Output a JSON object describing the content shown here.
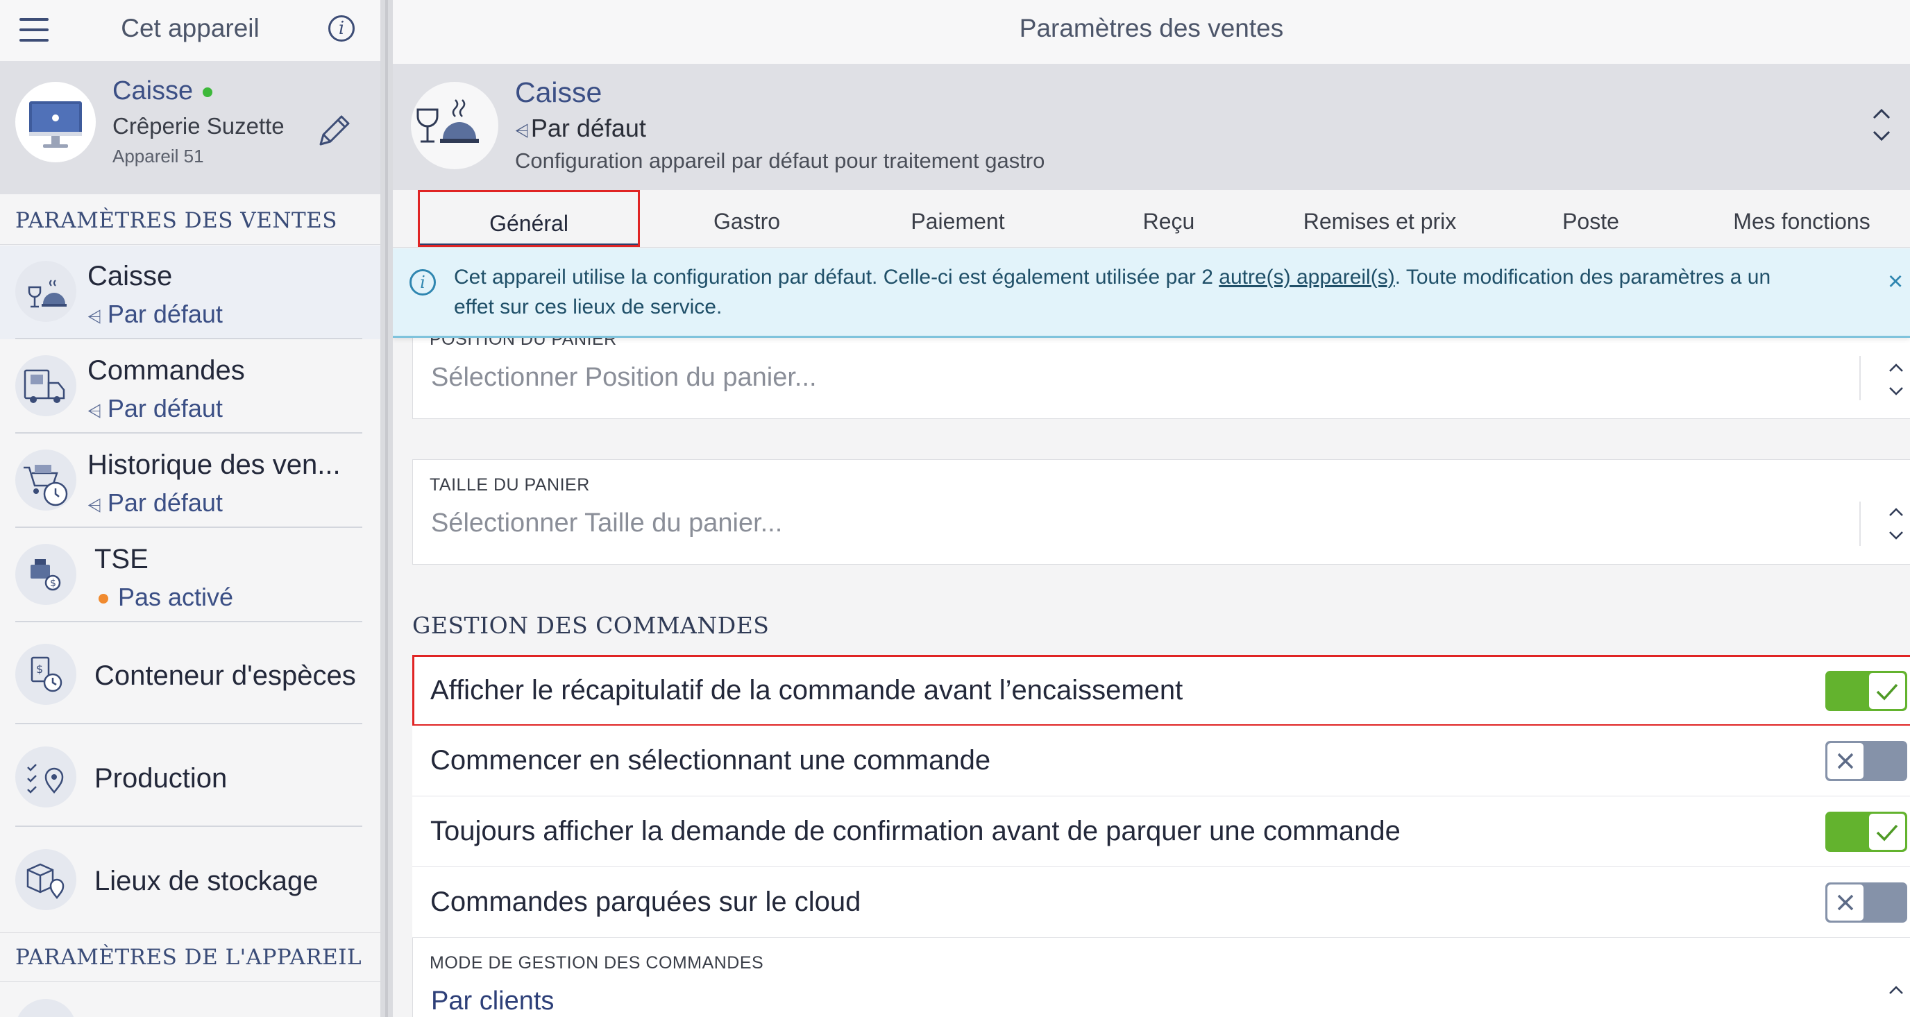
{
  "sidebar": {
    "header_title": "Cet appareil",
    "device": {
      "name": "Caisse",
      "status_color": "#3db83a",
      "location": "Crêperie Suzette",
      "device_id": "Appareil 51"
    },
    "section_sales": "PARAMÈTRES DES VENTES",
    "items": [
      {
        "icon": "register-icon",
        "title": "Caisse",
        "subtitle": "Par défaut",
        "active": true
      },
      {
        "icon": "delivery-truck-icon",
        "title": "Commandes",
        "subtitle": "Par défaut"
      },
      {
        "icon": "sales-history-icon",
        "title": "Historique des ven...",
        "subtitle": "Par défaut"
      },
      {
        "icon": "tse-icon",
        "title": "TSE",
        "subtitle": "Pas activé",
        "status_color": "#f08a2f"
      },
      {
        "icon": "cash-container-icon",
        "title": "Conteneur d'espèces"
      },
      {
        "icon": "production-icon",
        "title": "Production"
      },
      {
        "icon": "storage-location-icon",
        "title": "Lieux de stockage"
      }
    ],
    "section_device": "PARAMÈTRES DE L'APPAREIL"
  },
  "main": {
    "header_title": "Paramètres des ventes",
    "profile": {
      "name": "Caisse",
      "subtitle": "Par défaut",
      "description": "Configuration appareil par défaut pour traitement gastro"
    },
    "tabs": [
      {
        "label": "Général",
        "active": true
      },
      {
        "label": "Gastro"
      },
      {
        "label": "Paiement"
      },
      {
        "label": "Reçu"
      },
      {
        "label": "Remises et prix"
      },
      {
        "label": "Poste"
      },
      {
        "label": "Mes fonctions"
      }
    ],
    "banner": {
      "text_before": "Cet appareil utilise la configuration par défaut. Celle-ci est également utilisée par 2 ",
      "link": "autre(s) appareil(s)",
      "text_after": ". Toute modification des paramètres a un effet sur ces lieux de service."
    },
    "fields": {
      "cart_position": {
        "label": "POSITION DU PANIER",
        "placeholder": "Sélectionner Position du panier..."
      },
      "cart_size": {
        "label": "TAILLE DU PANIER",
        "placeholder": "Sélectionner Taille du panier..."
      }
    },
    "orders_section": "GESTION DES COMMANDES",
    "toggles": [
      {
        "label": "Afficher le récapitulatif de la commande avant l’encaissement",
        "on": true
      },
      {
        "label": "Commencer en sélectionnant une commande",
        "on": false
      },
      {
        "label": "Toujours afficher la demande de confirmation avant de parquer une commande",
        "on": true
      },
      {
        "label": "Commandes parquées sur le cloud",
        "on": false
      }
    ],
    "order_mode": {
      "label": "MODE DE GESTION DES COMMANDES",
      "value": "Par clients"
    }
  },
  "colors": {
    "accent": "#3b4f85",
    "toggle_on": "#63b32e",
    "toggle_off": "#8592a9",
    "highlight": "#e02424",
    "info_banner": "#e2f3fa"
  }
}
